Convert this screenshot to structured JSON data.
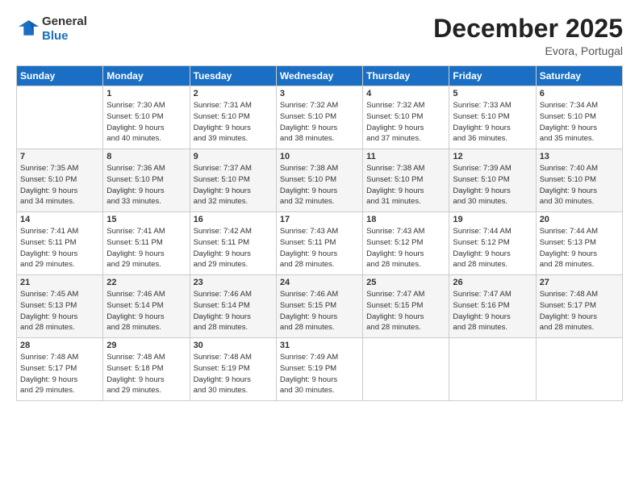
{
  "logo": {
    "general": "General",
    "blue": "Blue"
  },
  "header": {
    "title": "December 2025",
    "location": "Evora, Portugal"
  },
  "days_of_week": [
    "Sunday",
    "Monday",
    "Tuesday",
    "Wednesday",
    "Thursday",
    "Friday",
    "Saturday"
  ],
  "weeks": [
    [
      {
        "day": "",
        "info": ""
      },
      {
        "day": "1",
        "info": "Sunrise: 7:30 AM\nSunset: 5:10 PM\nDaylight: 9 hours\nand 40 minutes."
      },
      {
        "day": "2",
        "info": "Sunrise: 7:31 AM\nSunset: 5:10 PM\nDaylight: 9 hours\nand 39 minutes."
      },
      {
        "day": "3",
        "info": "Sunrise: 7:32 AM\nSunset: 5:10 PM\nDaylight: 9 hours\nand 38 minutes."
      },
      {
        "day": "4",
        "info": "Sunrise: 7:32 AM\nSunset: 5:10 PM\nDaylight: 9 hours\nand 37 minutes."
      },
      {
        "day": "5",
        "info": "Sunrise: 7:33 AM\nSunset: 5:10 PM\nDaylight: 9 hours\nand 36 minutes."
      },
      {
        "day": "6",
        "info": "Sunrise: 7:34 AM\nSunset: 5:10 PM\nDaylight: 9 hours\nand 35 minutes."
      }
    ],
    [
      {
        "day": "7",
        "info": "Sunrise: 7:35 AM\nSunset: 5:10 PM\nDaylight: 9 hours\nand 34 minutes."
      },
      {
        "day": "8",
        "info": "Sunrise: 7:36 AM\nSunset: 5:10 PM\nDaylight: 9 hours\nand 33 minutes."
      },
      {
        "day": "9",
        "info": "Sunrise: 7:37 AM\nSunset: 5:10 PM\nDaylight: 9 hours\nand 32 minutes."
      },
      {
        "day": "10",
        "info": "Sunrise: 7:38 AM\nSunset: 5:10 PM\nDaylight: 9 hours\nand 32 minutes."
      },
      {
        "day": "11",
        "info": "Sunrise: 7:38 AM\nSunset: 5:10 PM\nDaylight: 9 hours\nand 31 minutes."
      },
      {
        "day": "12",
        "info": "Sunrise: 7:39 AM\nSunset: 5:10 PM\nDaylight: 9 hours\nand 30 minutes."
      },
      {
        "day": "13",
        "info": "Sunrise: 7:40 AM\nSunset: 5:10 PM\nDaylight: 9 hours\nand 30 minutes."
      }
    ],
    [
      {
        "day": "14",
        "info": "Sunrise: 7:41 AM\nSunset: 5:11 PM\nDaylight: 9 hours\nand 29 minutes."
      },
      {
        "day": "15",
        "info": "Sunrise: 7:41 AM\nSunset: 5:11 PM\nDaylight: 9 hours\nand 29 minutes."
      },
      {
        "day": "16",
        "info": "Sunrise: 7:42 AM\nSunset: 5:11 PM\nDaylight: 9 hours\nand 29 minutes."
      },
      {
        "day": "17",
        "info": "Sunrise: 7:43 AM\nSunset: 5:11 PM\nDaylight: 9 hours\nand 28 minutes."
      },
      {
        "day": "18",
        "info": "Sunrise: 7:43 AM\nSunset: 5:12 PM\nDaylight: 9 hours\nand 28 minutes."
      },
      {
        "day": "19",
        "info": "Sunrise: 7:44 AM\nSunset: 5:12 PM\nDaylight: 9 hours\nand 28 minutes."
      },
      {
        "day": "20",
        "info": "Sunrise: 7:44 AM\nSunset: 5:13 PM\nDaylight: 9 hours\nand 28 minutes."
      }
    ],
    [
      {
        "day": "21",
        "info": "Sunrise: 7:45 AM\nSunset: 5:13 PM\nDaylight: 9 hours\nand 28 minutes."
      },
      {
        "day": "22",
        "info": "Sunrise: 7:46 AM\nSunset: 5:14 PM\nDaylight: 9 hours\nand 28 minutes."
      },
      {
        "day": "23",
        "info": "Sunrise: 7:46 AM\nSunset: 5:14 PM\nDaylight: 9 hours\nand 28 minutes."
      },
      {
        "day": "24",
        "info": "Sunrise: 7:46 AM\nSunset: 5:15 PM\nDaylight: 9 hours\nand 28 minutes."
      },
      {
        "day": "25",
        "info": "Sunrise: 7:47 AM\nSunset: 5:15 PM\nDaylight: 9 hours\nand 28 minutes."
      },
      {
        "day": "26",
        "info": "Sunrise: 7:47 AM\nSunset: 5:16 PM\nDaylight: 9 hours\nand 28 minutes."
      },
      {
        "day": "27",
        "info": "Sunrise: 7:48 AM\nSunset: 5:17 PM\nDaylight: 9 hours\nand 28 minutes."
      }
    ],
    [
      {
        "day": "28",
        "info": "Sunrise: 7:48 AM\nSunset: 5:17 PM\nDaylight: 9 hours\nand 29 minutes."
      },
      {
        "day": "29",
        "info": "Sunrise: 7:48 AM\nSunset: 5:18 PM\nDaylight: 9 hours\nand 29 minutes."
      },
      {
        "day": "30",
        "info": "Sunrise: 7:48 AM\nSunset: 5:19 PM\nDaylight: 9 hours\nand 30 minutes."
      },
      {
        "day": "31",
        "info": "Sunrise: 7:49 AM\nSunset: 5:19 PM\nDaylight: 9 hours\nand 30 minutes."
      },
      {
        "day": "",
        "info": ""
      },
      {
        "day": "",
        "info": ""
      },
      {
        "day": "",
        "info": ""
      }
    ]
  ]
}
